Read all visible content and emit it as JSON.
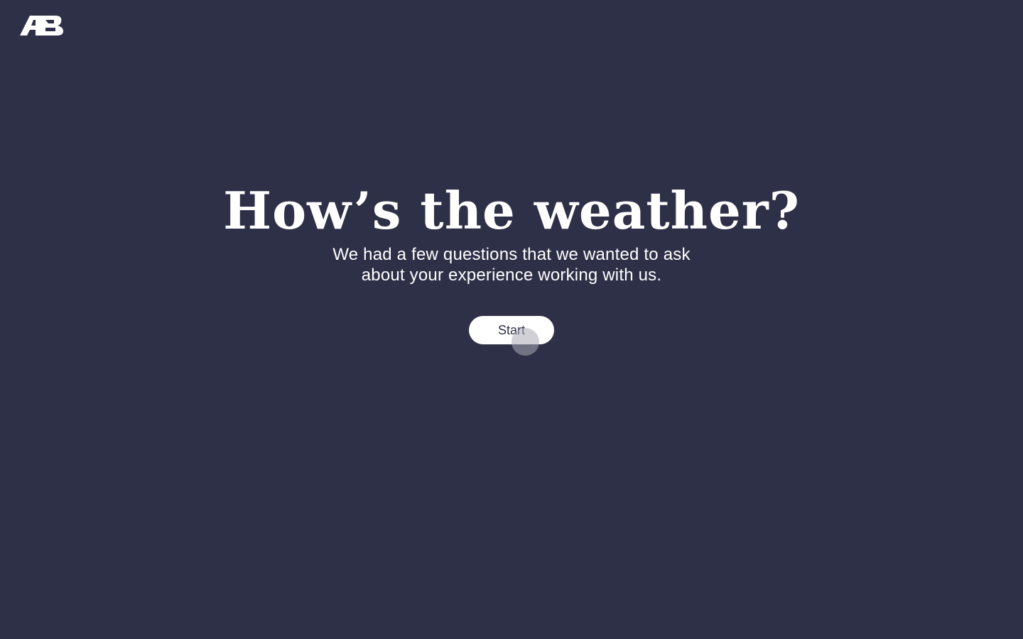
{
  "brand": {
    "logo_text": "AB",
    "logo_color": "#ffffff"
  },
  "hero": {
    "title": "How’s the weather?",
    "subtitle_line1": "We had a few questions that we wanted to ask",
    "subtitle_line2": "about your experience working with us.",
    "start_label": "Start"
  },
  "colors": {
    "background": "#2e3047",
    "text": "#ffffff",
    "button_bg": "#ffffff",
    "button_text": "#2e3047"
  }
}
